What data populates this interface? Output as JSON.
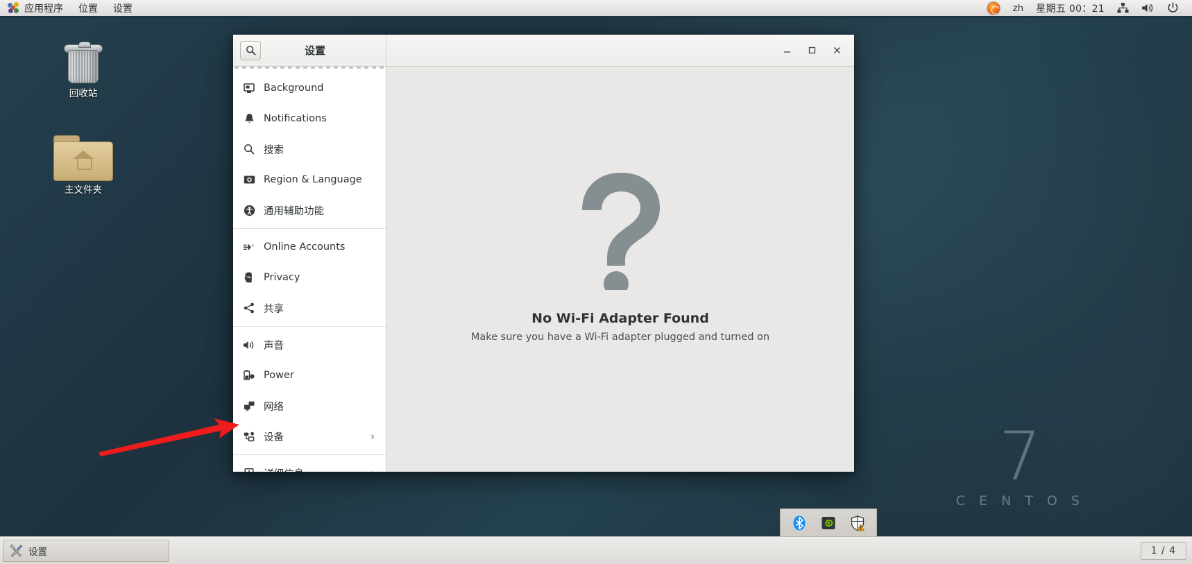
{
  "top_panel": {
    "apps_menu": "应用程序",
    "places_menu": "位置",
    "settings_menu": "设置",
    "firefox_icon": "firefox-icon",
    "language": "zh",
    "clock": "星期五 00：21",
    "network_icon": "network-icon",
    "volume_icon": "volume-icon",
    "power_icon": "power-icon"
  },
  "desktop": {
    "icons": [
      {
        "name": "trash",
        "label": "回收站",
        "icon": "trash-icon"
      },
      {
        "name": "home-folder",
        "label": "主文件夹",
        "icon": "folder-home-icon"
      }
    ],
    "watermark": {
      "number": "7",
      "word": "C E N T O S"
    }
  },
  "window": {
    "title": "设置",
    "search_icon": "search-icon",
    "minimize_label": "—",
    "maximize_label": "□",
    "close_label": "✕",
    "sidebar": {
      "items": [
        {
          "label": "Background",
          "icon": "monitor-icon",
          "chevron": "",
          "separator_after": false
        },
        {
          "label": "Notifications",
          "icon": "bell-icon",
          "chevron": "",
          "separator_after": false
        },
        {
          "label": "搜索",
          "icon": "search-icon",
          "chevron": "",
          "separator_after": false
        },
        {
          "label": "Region & Language",
          "icon": "flag-icon",
          "chevron": "",
          "separator_after": false
        },
        {
          "label": "通用辅助功能",
          "icon": "accessibility-icon",
          "chevron": "",
          "separator_after": true
        },
        {
          "label": "Online Accounts",
          "icon": "online-accounts-icon",
          "chevron": "",
          "separator_after": false
        },
        {
          "label": "Privacy",
          "icon": "hand-icon",
          "chevron": "",
          "separator_after": false
        },
        {
          "label": "共享",
          "icon": "share-icon",
          "chevron": "",
          "separator_after": true
        },
        {
          "label": "声音",
          "icon": "speaker-icon",
          "chevron": "",
          "separator_after": false
        },
        {
          "label": "Power",
          "icon": "battery-icon",
          "chevron": "",
          "separator_after": false
        },
        {
          "label": "网络",
          "icon": "network-icon",
          "chevron": "",
          "separator_after": false
        },
        {
          "label": "设备",
          "icon": "devices-icon",
          "chevron": "›",
          "separator_after": true
        },
        {
          "label": "详细信息",
          "icon": "info-icon",
          "chevron": "›",
          "separator_after": false
        }
      ]
    },
    "content": {
      "placeholder_icon": "question-mark-icon",
      "title": "No Wi-Fi Adapter Found",
      "subtitle": "Make sure you have a Wi-Fi adapter plugged and turned on"
    }
  },
  "taskbar": {
    "task_label": "设置",
    "task_icon": "tools-icon",
    "tray_icons": [
      "bluetooth-icon",
      "nvidia-icon",
      "security-shield-warning-icon"
    ],
    "workspace_indicator": "1 / 4"
  },
  "annotation": {
    "arrow": "red-arrow-pointing-right",
    "color": "#ee1c1c"
  }
}
